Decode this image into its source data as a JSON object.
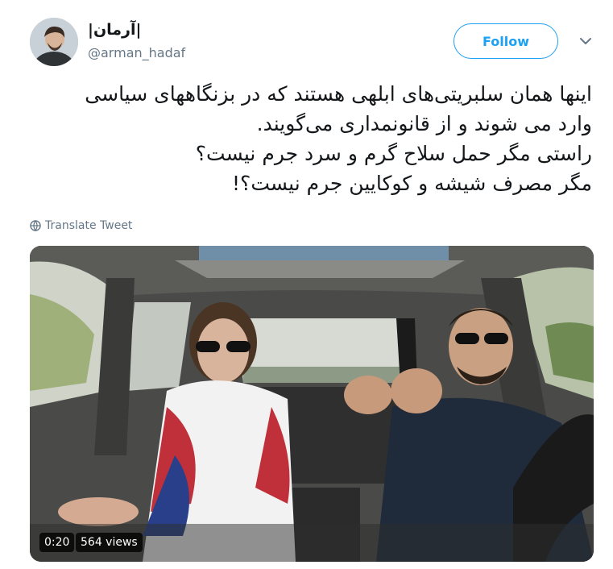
{
  "user": {
    "display_name": "|آرمان|",
    "handle": "@arman_hadaf",
    "avatar_icon": "user-avatar"
  },
  "follow_button": {
    "label": "Follow"
  },
  "more_menu": {
    "icon": "chevron-down-icon"
  },
  "tweet": {
    "text": "اینها همان سلبریتی‌های ابلهی هستند که در بزنگاههای سیاسی\nوارد می شوند و از قانونمداری می‌گویند.\nراستی مگر حمل سلاح گرم و سرد جرم نیست؟\nمگر مصرف شیشه و کوکایین جرم نیست؟!"
  },
  "translate": {
    "label": "Translate Tweet",
    "icon": "globe-icon"
  },
  "video": {
    "duration": "0:20",
    "views": "564 views"
  },
  "colors": {
    "accent": "#1da1f2",
    "secondary_text": "#657786",
    "primary_text": "#14171a"
  }
}
